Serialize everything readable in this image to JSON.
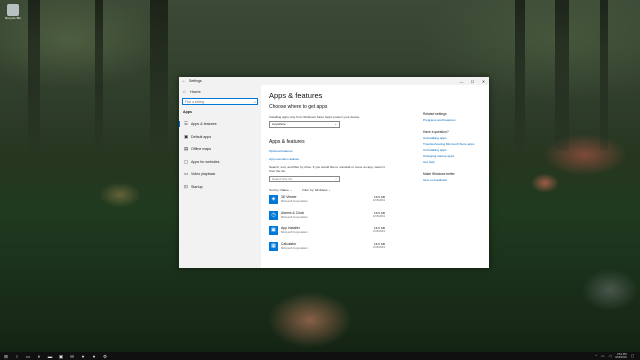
{
  "desktop": {
    "icon_label": "Recycle Bin"
  },
  "window": {
    "title": "Settings",
    "controls": {
      "minimize": "—",
      "maximize": "☐",
      "close": "✕"
    }
  },
  "sidebar": {
    "home_label": "Home",
    "search_placeholder": "Find a setting",
    "section_label": "Apps",
    "items": [
      {
        "label": "Apps & features",
        "icon": "list-icon"
      },
      {
        "label": "Default apps",
        "icon": "default-apps-icon"
      },
      {
        "label": "Offline maps",
        "icon": "map-icon"
      },
      {
        "label": "Apps for websites",
        "icon": "web-icon"
      },
      {
        "label": "Video playback",
        "icon": "video-icon"
      },
      {
        "label": "Startup",
        "icon": "startup-icon"
      }
    ]
  },
  "main": {
    "page_title": "Apps & features",
    "choose_heading": "Choose where to get apps",
    "choose_desc": "Installing apps only from Windows Store helps protect your device.",
    "source_dropdown": "Anywhere",
    "section_heading": "Apps & features",
    "optional_features_link": "Optional features",
    "execution_aliases_link": "App execution aliases",
    "search_desc": "Search, sort, and filter by drive. If you would like to uninstall or move an app, select it from the list.",
    "filter_placeholder": "Search this list",
    "sort_label": "Sort by:",
    "sort_value": "Name",
    "filter_label": "Filter by:",
    "filter_value": "All drives",
    "apps": [
      {
        "name": "3D Viewer",
        "publisher": "Microsoft Corporation",
        "size": "16.0 KB",
        "date": "3/15/2019"
      },
      {
        "name": "Alarms & Clock",
        "publisher": "Microsoft Corporation",
        "size": "16.0 KB",
        "date": "3/15/2019"
      },
      {
        "name": "App Installer",
        "publisher": "Microsoft Corporation",
        "size": "16.0 KB",
        "date": "3/15/2019"
      },
      {
        "name": "Calculator",
        "publisher": "Microsoft Corporation",
        "size": "16.0 KB",
        "date": "3/15/2019"
      }
    ]
  },
  "related": {
    "settings_heading": "Related settings",
    "settings_links": [
      "Programs and Features"
    ],
    "question_heading": "Have a question?",
    "question_links": [
      "Uninstalling apps",
      "Troubleshooting Microsoft Store apps",
      "Uninstalling apps",
      "Changing startup apps",
      "Get help"
    ],
    "better_heading": "Make Windows better",
    "better_links": [
      "Give us feedback"
    ]
  },
  "taskbar": {
    "time": "3:51 PM",
    "date": "3/16/2019"
  },
  "colors": {
    "accent": "#0078d7",
    "link": "#0067b8"
  }
}
